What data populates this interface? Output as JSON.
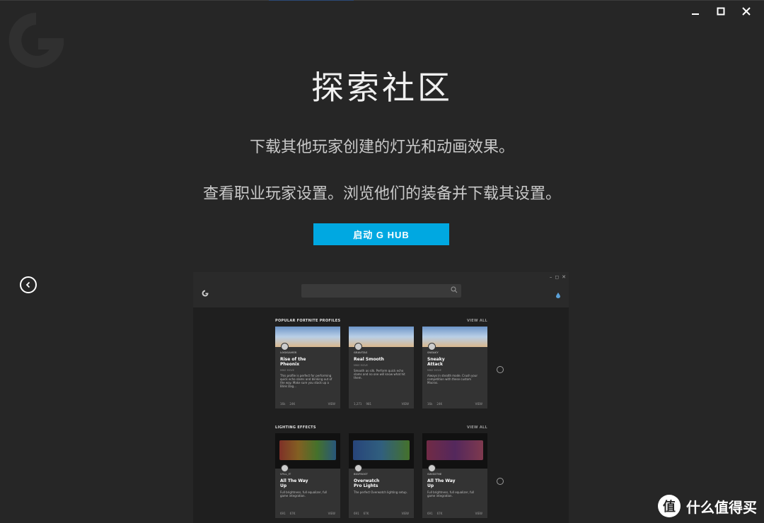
{
  "colors": {
    "background": "#262626",
    "accent": "#00a8e1",
    "preview_bg": "#1f1f1f"
  },
  "window": {
    "minimize_icon": "minimize-icon",
    "maximize_icon": "maximize-icon",
    "close_icon": "close-icon"
  },
  "hero": {
    "title": "探索社区",
    "line1": "下载其他玩家创建的灯光和动画效果。",
    "line2": "查看职业玩家设置。浏览他们的装备并下载其设置。",
    "launch_label": "启动 G HUB"
  },
  "preview": {
    "section1": {
      "title": "POPULAR FORTNITE PROFILES",
      "view_all": "VIEW ALL",
      "cards": [
        {
          "tag": "LOGIGAMER",
          "title": "Rise of the\nPheonix",
          "meta": "MIKE   MOVE",
          "desc": "This profile is perfect for performing quick echo slams and blinking out of the way. Make sure you stack up a Blink Dag...",
          "likes": "16k",
          "downloads": "24K",
          "view": "VIEW"
        },
        {
          "tag": "GRAVITAS",
          "title": "Real Smooth",
          "meta": "MIKE   MOVE",
          "desc": "Smooth as silk. Perform quick echo slams and no one will know what hit them.",
          "likes": "1,271",
          "downloads": "981",
          "view": "VIEW"
        },
        {
          "tag": "SNEAKY",
          "title": "Sneaky\nAttack",
          "meta": "MIKE   MOVE",
          "desc": "Always in stealth mode. Crush your competition with these custom Macros.",
          "likes": "16k",
          "downloads": "24K",
          "view": "VIEW"
        }
      ]
    },
    "section2": {
      "title": "LIGHTING EFFECTS",
      "view_all": "VIEW ALL",
      "cards": [
        {
          "tag": "VYLL_IT",
          "title": "All The Way\nUp",
          "desc": "Full brightness, full equalizer, full game integration.",
          "likes": "691",
          "downloads": "67K",
          "view": "VIEW"
        },
        {
          "tag": "BIGFROST",
          "title": "Overwatch\nPro Lights",
          "desc": "The perfect Overwatch lighting setup.",
          "likes": "691",
          "downloads": "67K",
          "view": "VIEW"
        },
        {
          "tag": "SWISSTHE",
          "title": "All The Way\nUp",
          "desc": "Full brightness, full equalizer, full game integration.",
          "likes": "691",
          "downloads": "67K",
          "view": "VIEW"
        }
      ]
    }
  },
  "watermark": {
    "icon_text": "值",
    "text": "什么值得买"
  }
}
